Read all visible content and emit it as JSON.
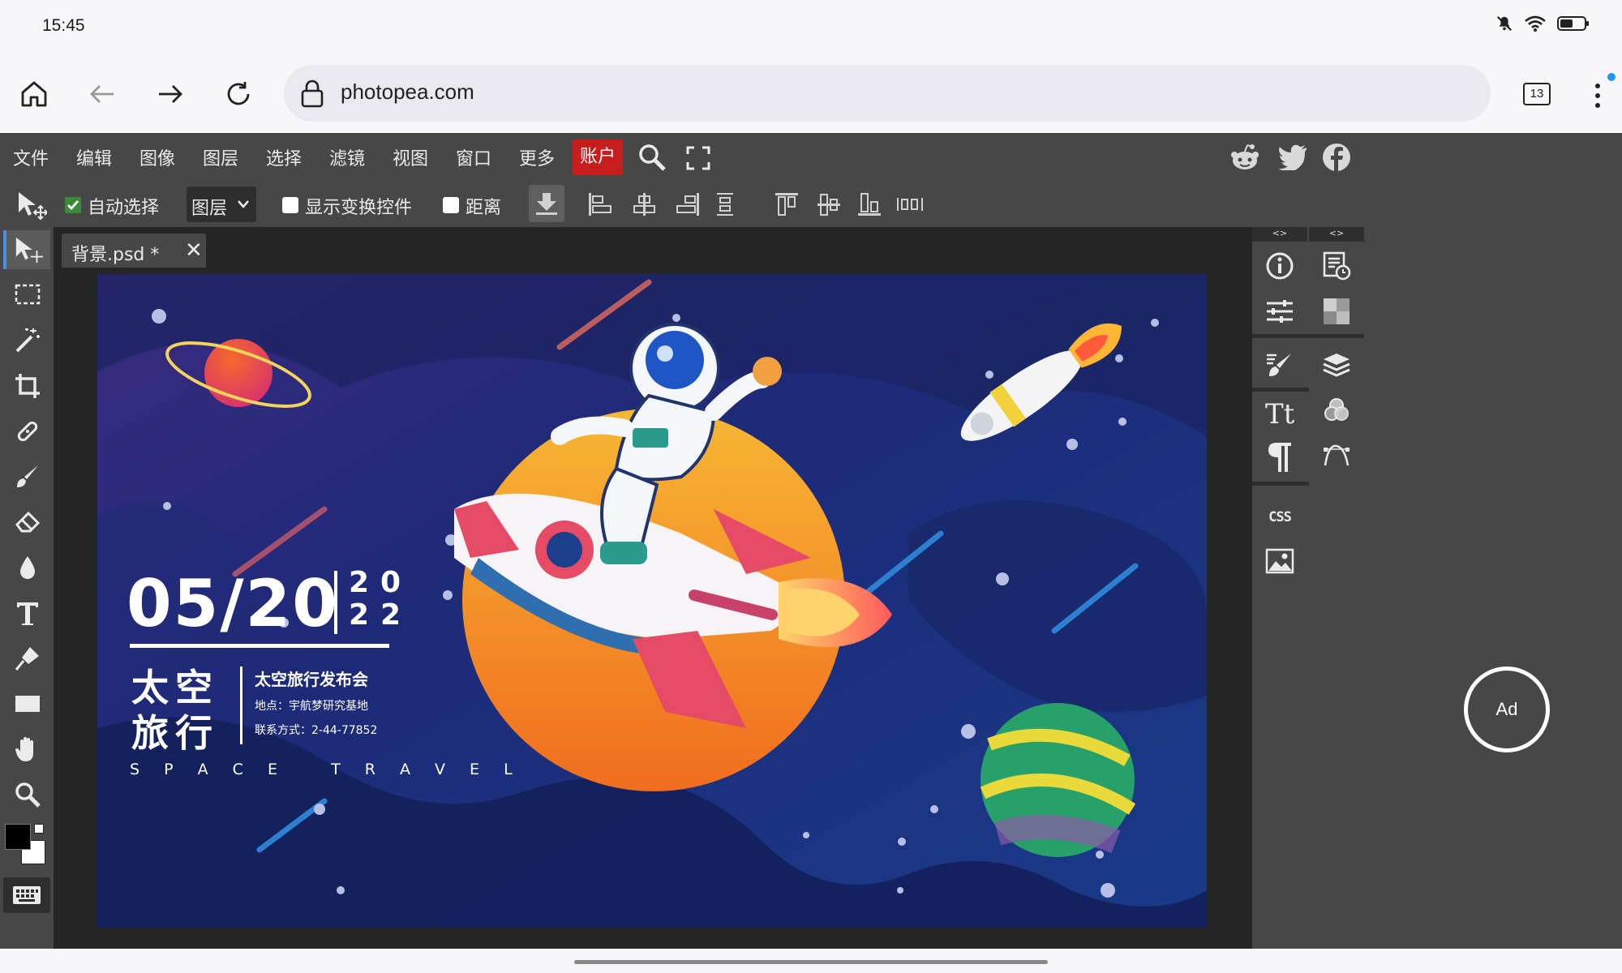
{
  "status": {
    "time": "15:45"
  },
  "browser": {
    "url": "photopea.com",
    "tabs_count": "13"
  },
  "menu": {
    "items": [
      "文件",
      "编辑",
      "图像",
      "图层",
      "选择",
      "滤镜",
      "视图",
      "窗口",
      "更多"
    ],
    "account": "账户"
  },
  "options": {
    "auto_select_label": "自动选择",
    "layer_select_value": "图层",
    "show_transform_label": "显示变换控件",
    "distance_label": "距离"
  },
  "document": {
    "tab_label": "背景.psd *",
    "close_glyph": "✕"
  },
  "poster": {
    "date": "05/20",
    "year_top": "20",
    "year_bottom": "22",
    "title_line1": "太空",
    "title_line2": "旅行",
    "subtitle": "太空旅行发布会",
    "location": "地点：宇航梦研究基地",
    "contact": "联系方式：2-44-77852",
    "english": "S P A C E   T R A V E L"
  },
  "panels": {
    "handle": "<>",
    "css_label": "CSS"
  },
  "ad": {
    "label": "Ad"
  },
  "colors": {
    "accent": "#c81d1d",
    "bg_panel": "#474747",
    "workspace": "#262626"
  }
}
